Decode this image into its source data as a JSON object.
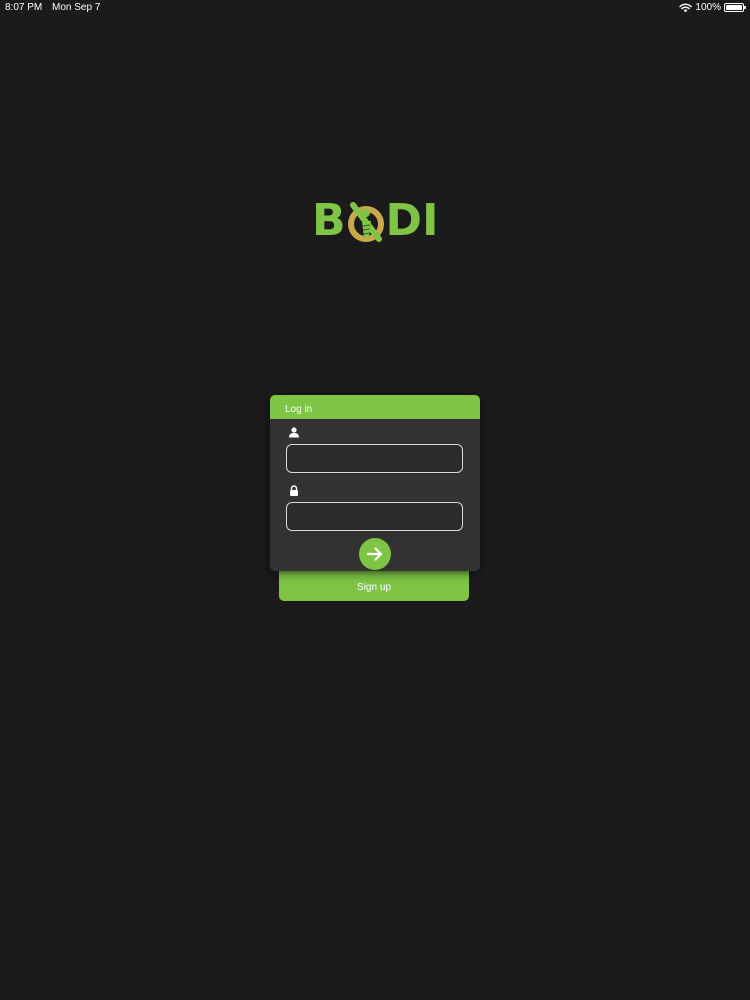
{
  "status_bar": {
    "time": "8:07 PM",
    "date": "Mon Sep 7",
    "battery": "100%",
    "icons": [
      "wifi-icon",
      "battery-icon"
    ]
  },
  "logo": {
    "text_left": "B",
    "text_right": "DI",
    "mark_icon": "figure-in-circle-icon",
    "color": "#7fc445",
    "mark_color": "#c9a74b"
  },
  "login": {
    "header": "Log in",
    "username_icon": "user-icon",
    "password_icon": "lock-icon",
    "username_value": "",
    "password_value": "",
    "submit_icon": "arrow-right-icon"
  },
  "signup": {
    "label": "Sign up"
  },
  "colors": {
    "background": "#1c1b1c",
    "card": "#323233",
    "accent": "#7fc445"
  }
}
